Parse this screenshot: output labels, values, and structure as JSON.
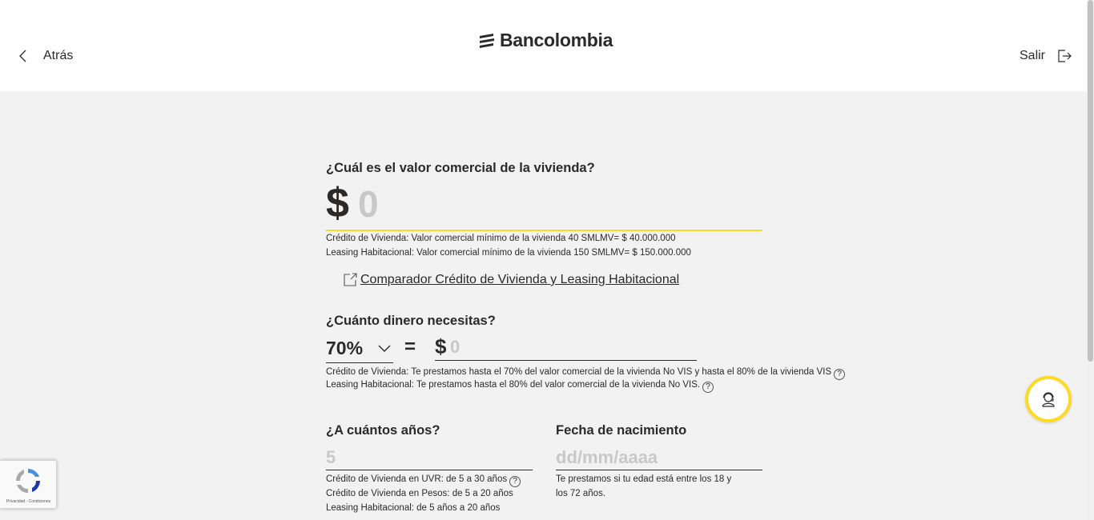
{
  "header": {
    "back_label": "Atrás",
    "brand": "Bancolombia",
    "exit_label": "Salir"
  },
  "property_value": {
    "question": "¿Cuál es el valor comercial de la vivienda?",
    "currency_symbol": "$",
    "placeholder": "0",
    "hint_credit": "Crédito de Vivienda: Valor comercial mínimo de la vivienda 40 SMLMV= $ 40.000.000",
    "hint_leasing": "Leasing Habitacional: Valor comercial mínimo de la vivienda 150 SMLMV= $ 150.000.000"
  },
  "comparator_link": " Comparador Crédito de Vivienda y Leasing Habitacional",
  "loan_amount": {
    "question": "¿Cuánto dinero necesitas?",
    "percent_selected": "70%",
    "equals": "=",
    "currency_symbol": "$",
    "placeholder": "0",
    "hint_credit": "Crédito de Vivienda: Te prestamos hasta el 70% del valor comercial de la vivienda No VIS y hasta el 80% de la vivienda VIS",
    "hint_leasing": "Leasing Habitacional: Te prestamos hasta el 80% del valor comercial de la vivienda No VIS."
  },
  "years": {
    "question": "¿A cuántos años?",
    "placeholder": "5",
    "hint_uvr": "Crédito de Vivienda en UVR: de 5 a 30 años",
    "hint_pesos": "Crédito de Vivienda en Pesos: de 5 a 20 años",
    "hint_leasing": "Leasing Habitacional: de 5 años a 20 años"
  },
  "birthdate": {
    "question": "Fecha de nacimiento",
    "placeholder": "dd/mm/aaaa",
    "hint_line1": "Te prestamos si tu edad está entre los 18 y",
    "hint_line2": "los 72 años."
  },
  "help_mark": "?",
  "recaptcha": {
    "text": "Privacidad - Condiciones"
  },
  "colors": {
    "accent": "#fdda24",
    "text": "#2c2a29",
    "background": "#f2f2f2"
  }
}
